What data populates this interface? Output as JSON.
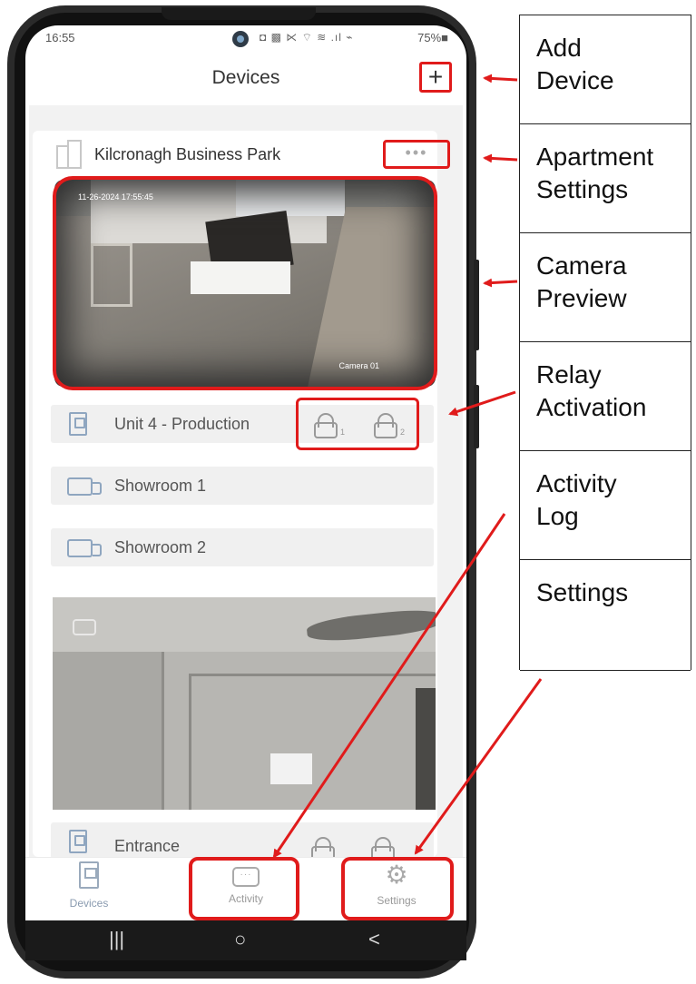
{
  "status_bar": {
    "time": "16:55",
    "icons": "◘ ▩ ⋉ ⌔ ≋ .ıl ⌁",
    "battery": "75%■"
  },
  "header": {
    "title": "Devices",
    "add_label": "+"
  },
  "site": {
    "name": "Kilcronagh Business Park",
    "more_label": "•••"
  },
  "preview": {
    "timestamp": "11-26-2024 17:55:45",
    "camera_name": "Camera 01"
  },
  "devices": [
    {
      "label": "Unit 4 - Production",
      "icon": "door-station-icon",
      "relays": [
        "1",
        "2"
      ]
    },
    {
      "label": "Showroom 1",
      "icon": "camera-icon"
    },
    {
      "label": "Showroom 2",
      "icon": "camera-icon"
    },
    {
      "label": "Entrance",
      "icon": "door-station-icon",
      "relays": [
        "1",
        "2"
      ]
    }
  ],
  "bottom_nav": [
    {
      "label": "Devices",
      "icon": "door-station-icon"
    },
    {
      "label": "Activity",
      "icon": "chat-bubble-icon"
    },
    {
      "label": "Settings",
      "icon": "gear-icon"
    }
  ],
  "system_nav": {
    "recents": "|||",
    "home": "○",
    "back": "<"
  },
  "callouts": [
    {
      "lines": [
        "Add",
        "Device"
      ]
    },
    {
      "lines": [
        "Apartment",
        "Settings"
      ]
    },
    {
      "lines": [
        "Camera",
        "Preview"
      ]
    },
    {
      "lines": [
        "Relay",
        "Activation"
      ]
    },
    {
      "lines": [
        "Activity",
        "Log"
      ]
    },
    {
      "lines": [
        "Settings"
      ]
    }
  ],
  "colors": {
    "highlight": "#e01b1b",
    "icon_blue": "#8fa6c0",
    "phone_body": "#2a2a2a"
  }
}
